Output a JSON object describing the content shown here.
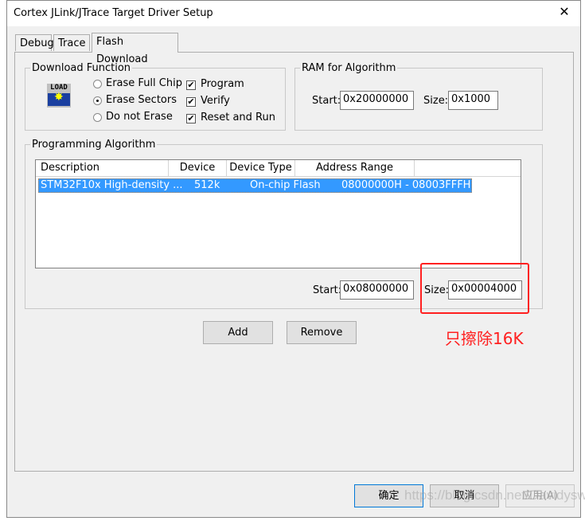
{
  "window": {
    "title": "Cortex JLink/JTrace Target Driver Setup",
    "close": "✕"
  },
  "tabs": [
    {
      "label": "Debug"
    },
    {
      "label": "Trace"
    },
    {
      "label": "Flash Download",
      "active": true
    }
  ],
  "download_function": {
    "legend": "Download Function",
    "icon_text": "LOAD",
    "erase_options": [
      {
        "label": "Erase Full Chip",
        "selected": false
      },
      {
        "label": "Erase Sectors",
        "selected": true
      },
      {
        "label": "Do not Erase",
        "selected": false
      }
    ],
    "checks": [
      {
        "label": "Program",
        "checked": true
      },
      {
        "label": "Verify",
        "checked": true
      },
      {
        "label": "Reset and Run",
        "checked": true
      }
    ]
  },
  "ram": {
    "legend": "RAM for Algorithm",
    "start_label": "Start:",
    "start": "0x20000000",
    "size_label": "Size:",
    "size": "0x1000"
  },
  "programming": {
    "legend": "Programming Algorithm",
    "columns": [
      "Description",
      "Device Size",
      "Device Type",
      "Address Range"
    ],
    "rows": [
      [
        "STM32F10x High-density ...",
        "512k",
        "On-chip Flash",
        "08000000H - 08003FFFH"
      ]
    ],
    "start_label": "Start:",
    "start": "0x08000000",
    "size_label": "Size:",
    "size": "0x00004000",
    "add": "Add",
    "remove": "Remove"
  },
  "annotation": {
    "text": "只擦除16K",
    "color": "#ff2020"
  },
  "footer": {
    "ok": "确定",
    "cancel": "取消",
    "apply": "应用(A)"
  },
  "watermark": "https://blog.csdn.net/Davidysw",
  "colors": {
    "selection": "#3399ff",
    "dialog_bg": "#f0f0f0"
  }
}
